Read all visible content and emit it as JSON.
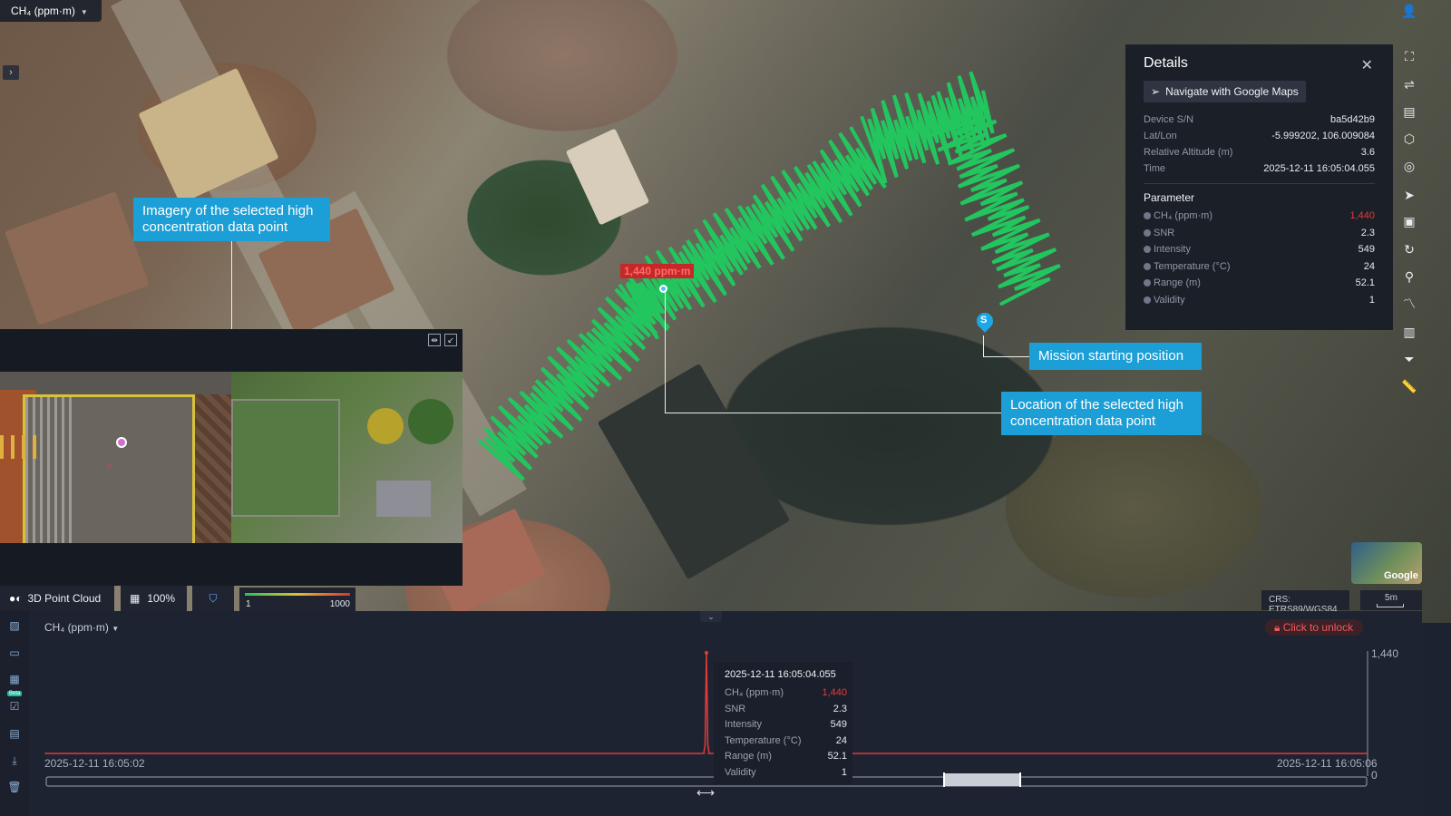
{
  "map": {
    "layer_dropdown": "CH₄ (ppm·m)",
    "marker_label": "1,440 ppm·m",
    "start_marker": "S",
    "callouts": {
      "imagery": "Imagery of the selected high concentration data point",
      "start": "Mission starting position",
      "location": "Location of the selected high concentration data point"
    },
    "toolbar": {
      "point_cloud": "3D Point Cloud",
      "opacity": "100%",
      "range_min": "1",
      "range_max": "1000"
    },
    "attribution": "Google",
    "crs": "CRS: ETRS89/WGS84",
    "scale": "5m"
  },
  "details": {
    "title": "Details",
    "navigate": "Navigate with Google Maps",
    "info": [
      {
        "k": "Device S/N",
        "v": "ba5d42b9"
      },
      {
        "k": "Lat/Lon",
        "v": "-5.999202, 106.009084"
      },
      {
        "k": "Relative Altitude (m)",
        "v": "3.6"
      },
      {
        "k": "Time",
        "v": "2025-12-11 16:05:04.055"
      }
    ],
    "parameter_title": "Parameter",
    "params": [
      {
        "k": "CH₄ (ppm·m)",
        "v": "1,440",
        "highlight": true
      },
      {
        "k": "SNR",
        "v": "2.3"
      },
      {
        "k": "Intensity",
        "v": "549"
      },
      {
        "k": "Temperature (°C)",
        "v": "24"
      },
      {
        "k": "Range (m)",
        "v": "52.1"
      },
      {
        "k": "Validity",
        "v": "1"
      }
    ]
  },
  "chart_panel": {
    "dropdown": "CH₄ (ppm·m)",
    "unlock": "Click to unlock",
    "beta": "Beta",
    "x_start": "2025-12-11 16:05:02",
    "x_end": "2025-12-11 16:05:06",
    "y_max_label": "1,440",
    "y_min_label": "0",
    "tooltip": {
      "time": "2025-12-11 16:05:04.055",
      "rows": [
        {
          "k": "CH₄ (ppm·m)",
          "v": "1,440",
          "highlight": true
        },
        {
          "k": "SNR",
          "v": "2.3"
        },
        {
          "k": "Intensity",
          "v": "549"
        },
        {
          "k": "Temperature (°C)",
          "v": "24"
        },
        {
          "k": "Range (m)",
          "v": "52.1"
        },
        {
          "k": "Validity",
          "v": "1"
        }
      ]
    }
  },
  "chart_data": {
    "type": "line",
    "title": "",
    "xlabel": "",
    "ylabel": "CH₄ (ppm·m)",
    "x": [
      "16:05:02",
      "16:05:03",
      "16:05:03.9",
      "16:05:04.0",
      "16:05:04.055",
      "16:05:04.1",
      "16:05:04.2",
      "16:05:05",
      "16:05:06"
    ],
    "series": [
      {
        "values": [
          0,
          0,
          0,
          120,
          1440,
          120,
          0,
          0,
          0
        ]
      }
    ],
    "ylim": [
      0,
      1440
    ],
    "grid": false,
    "colors": {
      "line": "#e23b3b",
      "accent": "#1b9fd6",
      "track": "#22c55e"
    }
  }
}
